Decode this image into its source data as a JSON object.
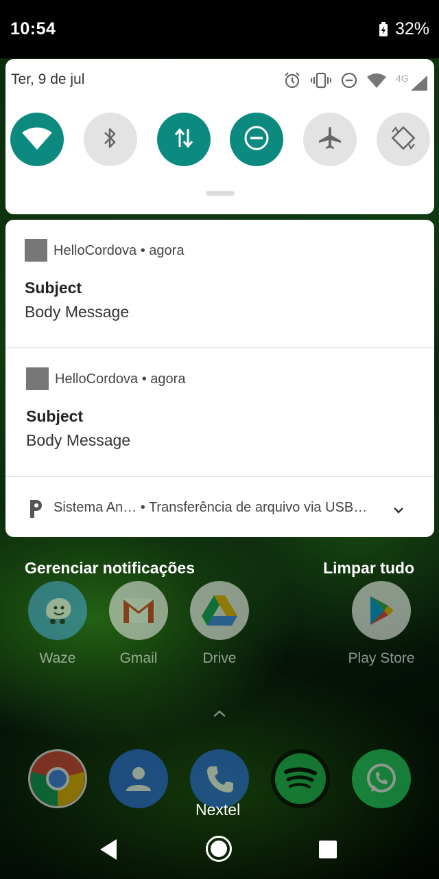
{
  "status_bar": {
    "time": "10:54",
    "battery": "32%"
  },
  "quick_settings": {
    "date": "Ter, 9 de jul",
    "status_icons": [
      "alarm-icon",
      "vibrate-icon",
      "do-not-disturb-icon",
      "wifi-icon",
      "4g-signal-icon"
    ],
    "signal_label": "4G",
    "tiles": [
      {
        "name": "wifi",
        "state": "on"
      },
      {
        "name": "bluetooth",
        "state": "off"
      },
      {
        "name": "mobile-data",
        "state": "on"
      },
      {
        "name": "do-not-disturb",
        "state": "on"
      },
      {
        "name": "airplane-mode",
        "state": "off"
      },
      {
        "name": "auto-rotate",
        "state": "off"
      }
    ]
  },
  "notifications": [
    {
      "app": "HelloCordova",
      "time": "agora",
      "subject": "Subject",
      "body": "Body Message"
    },
    {
      "app": "HelloCordova",
      "time": "agora",
      "subject": "Subject",
      "body": "Body Message"
    },
    {
      "app": "Sistema An…",
      "text": "Transferência de arquivo via USB…"
    }
  ],
  "actions": {
    "manage": "Gerenciar notificações",
    "clear_all": "Limpar tudo"
  },
  "home": {
    "row": [
      {
        "label": "Waze"
      },
      {
        "label": "Gmail"
      },
      {
        "label": "Drive"
      },
      {
        "label": "Play Store"
      }
    ],
    "dock_label": "Nextel"
  },
  "colors": {
    "accent": "#0d8a80",
    "tile_off": "#e3e3e3"
  }
}
